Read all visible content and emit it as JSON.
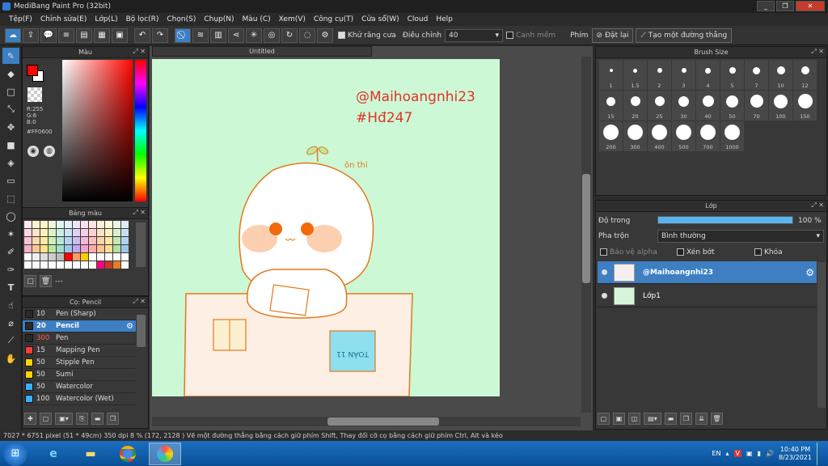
{
  "window": {
    "title": "MediBang Paint Pro (32bit)",
    "minimize": "_",
    "restore": "❐",
    "close": "✕"
  },
  "menu": [
    "Tệp(F)",
    "Chỉnh sửa(E)",
    "Lớp(L)",
    "Bộ lọc(R)",
    "Chọn(S)",
    "Chụp(N)",
    "Màu (C)",
    "Xem(V)",
    "Công cụ(T)",
    "Cửa sổ(W)",
    "Cloud",
    "Help"
  ],
  "toolbar": {
    "antialias_label": "Khử răng cưa",
    "adjust_label": "Điều chỉnh",
    "adjust_value": "40",
    "snap_label": "Canh mềm",
    "brush_label": "Phím",
    "reset_label": "Đặt lại",
    "straight_line_label": "Tạo một đường thẳng"
  },
  "color_panel": {
    "title": "Màu",
    "r": "R:255",
    "g": "G:6",
    "b": "B:0",
    "hex": "#FF0600",
    "fg_color": "#ff0600",
    "bg_color": "#ffffff"
  },
  "palette_panel": {
    "title": "Bảng màu",
    "colors": [
      "#fde9f0",
      "#fdf2d0",
      "#fff6c8",
      "#eef9d9",
      "#dff5ef",
      "#e0f0fb",
      "#ece4f8",
      "#fbe0ef",
      "#ffe4e4",
      "#fff0dc",
      "#fff8d9",
      "#e9f7e0",
      "#dcecf6",
      "#f9d7e3",
      "#fde4c6",
      "#fff0b8",
      "#def3c9",
      "#c9efe4",
      "#cae3f7",
      "#ddd2f3",
      "#f7cde6",
      "#ffd2d2",
      "#ffe2c4",
      "#fff0c2",
      "#d9f1cc",
      "#c9e0f3",
      "#f5c2d4",
      "#fcd6b0",
      "#ffe9a0",
      "#cdeeb4",
      "#b4e7d7",
      "#b4d5f3",
      "#cdbdee",
      "#f2b7db",
      "#ffbdbd",
      "#ffd3aa",
      "#ffe6a5",
      "#c6e9b3",
      "#b3d2ef",
      "#f2b0c6",
      "#fbc798",
      "#ffe28a",
      "#bde79f",
      "#a0dfca",
      "#a0c8ef",
      "#bea9e9",
      "#eea2cf",
      "#ffaaaa",
      "#ffc493",
      "#ffdd8f",
      "#b4e29e",
      "#9ec5ec",
      "#ffffff",
      "#eeeeee",
      "#dddddd",
      "#cccccc",
      "#bbbbbb",
      "#ff0000",
      "#ff9966",
      "#ffcc00",
      "#ffffff",
      "#ffffff",
      "#ffffff",
      "#ffffff",
      "#ffffff",
      "#ffffff",
      "#ffffff",
      "#ffffff",
      "#ffffff",
      "#ffffff",
      "#ffffff",
      "#ffffff",
      "#ffffff",
      "#ffffff",
      "#ff0080",
      "#c0392b",
      "#e67e22",
      "#ffffff"
    ],
    "footer_text": "---"
  },
  "brush_panel": {
    "title": "Cọ: Pencil",
    "items": [
      {
        "size": "10",
        "name": "Pen (Sharp)",
        "color": "#2a2a2a",
        "size_color": "#ddd"
      },
      {
        "size": "20",
        "name": "Pencil",
        "color": "#2a2a2a",
        "size_color": "#fff",
        "selected": true
      },
      {
        "size": "300",
        "name": "Pen",
        "color": "#2a2a2a",
        "size_color": "#ff5a4a"
      },
      {
        "size": "15",
        "name": "Mapping Pen",
        "color": "#ff3a3a",
        "size_color": "#ddd"
      },
      {
        "size": "50",
        "name": "Stipple Pen",
        "color": "#ffd400",
        "size_color": "#ddd"
      },
      {
        "size": "50",
        "name": "Sumi",
        "color": "#ffd400",
        "size_color": "#ddd"
      },
      {
        "size": "50",
        "name": "Watercolor",
        "color": "#3ab0ff",
        "size_color": "#ddd"
      },
      {
        "size": "100",
        "name": "Watercolor (Wet)",
        "color": "#3ab0ff",
        "size_color": "#ddd"
      }
    ]
  },
  "document": {
    "tab_title": "Untitled",
    "canvas_bg": "#cdf8d5",
    "artwork_text1": "@Maihoangnhi23",
    "artwork_text2": "#Hđ247",
    "artwork_text3": "ôn thi",
    "artwork_book": "TOÁN 11"
  },
  "brush_size_panel": {
    "title": "Brush Size",
    "sizes": [
      "1",
      "1.5",
      "2",
      "3",
      "4",
      "5",
      "7",
      "10",
      "12",
      "15",
      "20",
      "25",
      "30",
      "40",
      "50",
      "70",
      "100",
      "150",
      "200",
      "300",
      "400",
      "500",
      "700",
      "1000"
    ]
  },
  "layer_panel": {
    "title": "Lớp",
    "opacity_label": "Độ trong",
    "opacity_value": "100 %",
    "opacity_fraction": 1.0,
    "blend_label": "Pha trộn",
    "blend_value": "Bình thường",
    "protect_alpha": "Bảo vệ alpha",
    "clipping": "Xén bớt",
    "lock": "Khóa",
    "layers": [
      {
        "name": "@Maihoangnhi23",
        "selected": true
      },
      {
        "name": "Lớp1",
        "selected": false
      }
    ]
  },
  "status": {
    "text": "7027 * 6751 pixel  (51 * 49cm)  350 dpi  8 %  (172, 2128 )  Vẽ một đường thẳng bằng cách giữ phím Shift, Thay đổi cỡ cọ bằng cách giữ phím Ctrl, Alt và kéo"
  },
  "taskbar": {
    "lang": "EN",
    "time": "10:40 PM",
    "date": "8/23/2021"
  },
  "colors": {
    "accent": "#3d7fc2",
    "taskbar": "#1b6fbf",
    "artwork_stroke": "#e07a1a",
    "artwork_text": "#e0342a"
  }
}
